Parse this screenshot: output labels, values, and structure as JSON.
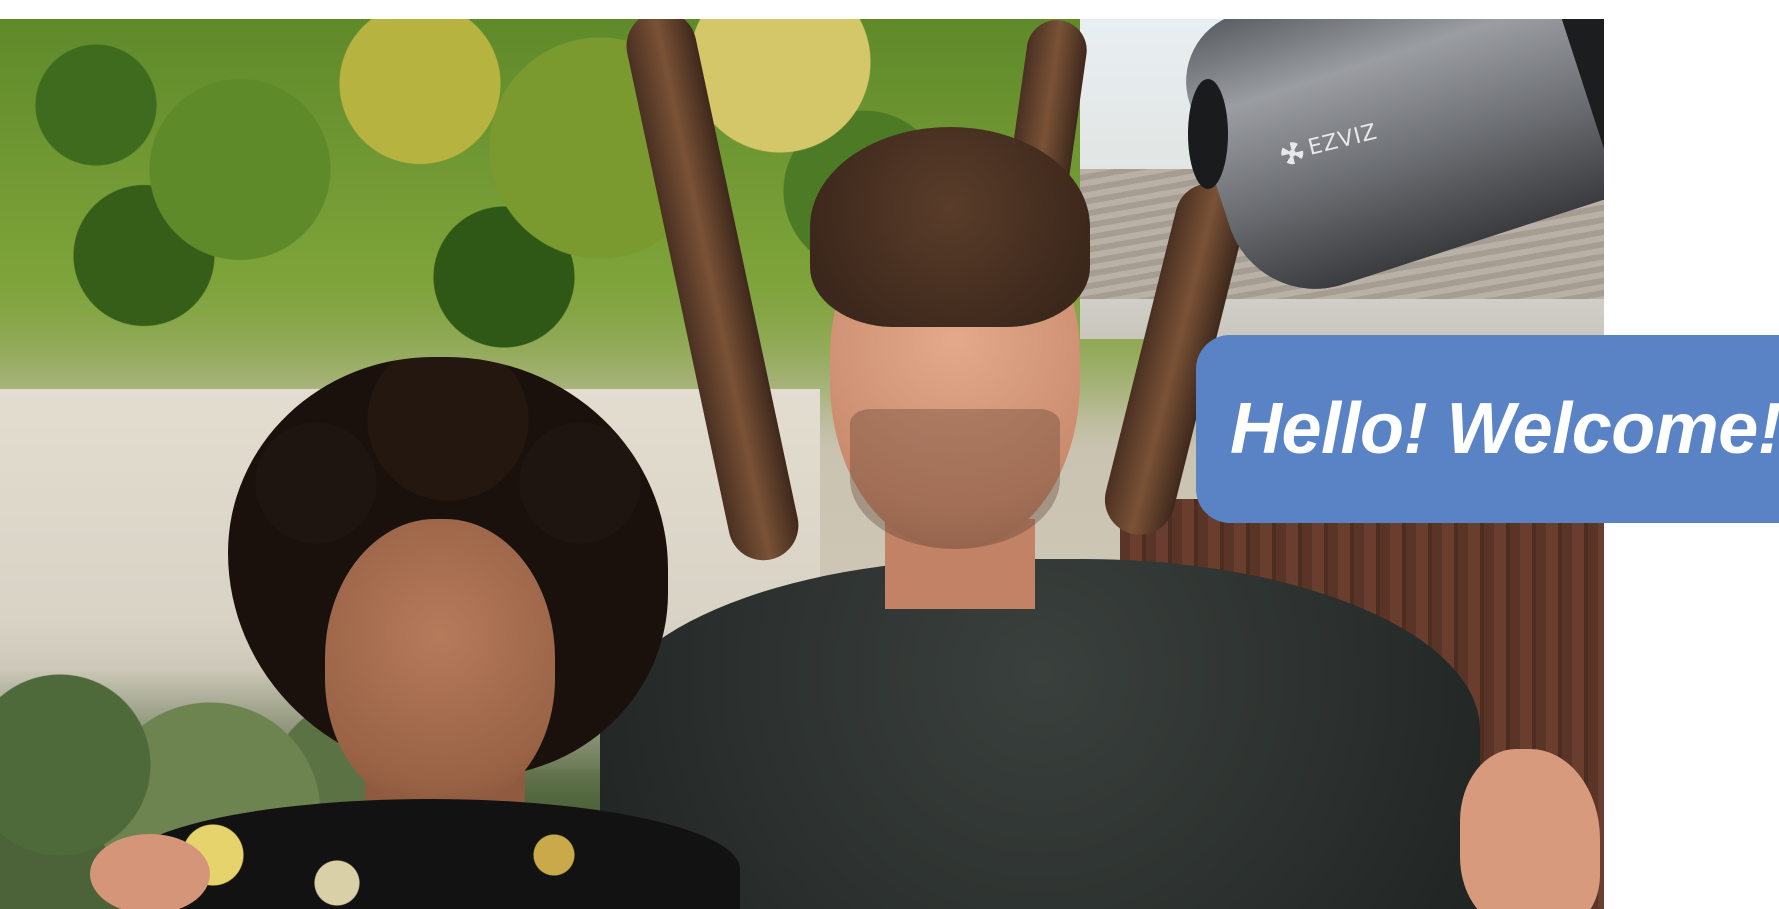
{
  "photo": {
    "subjects": [
      "woman",
      "man"
    ],
    "setting": "backyard with trees, wall and wooden fence"
  },
  "camera": {
    "brand_logo_text": "EZVIZ",
    "logo_icon": "ezviz-fan-icon",
    "body_color": "#8a8d91"
  },
  "bubble": {
    "text": "Hello! Welcome!",
    "background_color": "#5a83c6",
    "text_color": "#ffffff"
  }
}
